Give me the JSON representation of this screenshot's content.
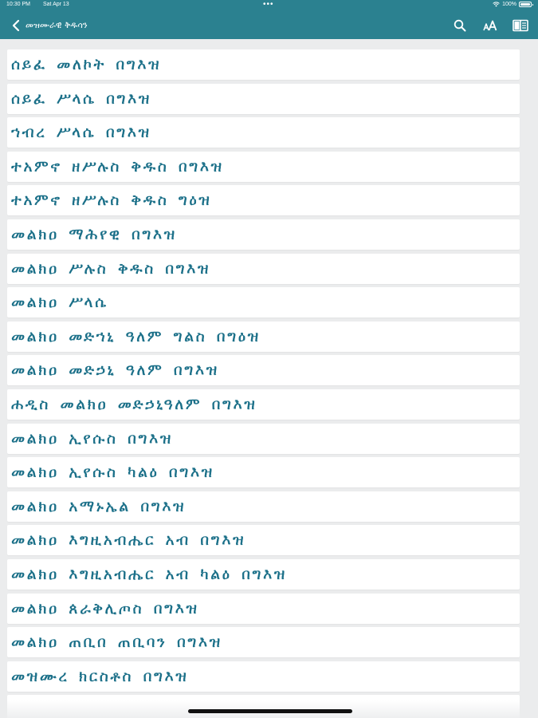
{
  "status_bar": {
    "time": "10:30 PM",
    "date": "Sat Apr 13",
    "dots": "•••",
    "battery": "100%"
  },
  "nav": {
    "title": "መዝሙራዊ ቅዱሳን",
    "back_icon": "chevron-left-icon",
    "actions": [
      "search-icon",
      "text-size-icon",
      "book-icon"
    ]
  },
  "colors": {
    "header": "#2b8190",
    "item_text": "#1a6f88",
    "background": "#ebeced",
    "item_background": "#ffffff"
  },
  "list": {
    "items": [
      {
        "label": "ሰይፈ መለኮት በግእዝ"
      },
      {
        "label": "ሰይፈ ሥላሴ በግእዝ"
      },
      {
        "label": "ኀብረ ሥላሴ በግእዝ"
      },
      {
        "label": "ተአምኖ ዘሥሉስ ቅዱስ በግእዝ"
      },
      {
        "label": "ተአምኖ ዘሥሉስ ቅዱስ ግዕዝ"
      },
      {
        "label": "መልክዐ ማሕየዊ በግእዝ"
      },
      {
        "label": "መልክዐ ሥሉስ ቅዱስ በግእዝ"
      },
      {
        "label": "መልክዐ ሥላሴ"
      },
      {
        "label": "መልክዐ መድኀኒ ዓለም ግልስ በግዕዝ"
      },
      {
        "label": "መልክዐ መድኃኒ ዓለም በግእዝ"
      },
      {
        "label": "ሐዲስ መልክዐ መድኃኒዓለም በግእዝ"
      },
      {
        "label": "መልክዐ ኢየሱስ በግእዝ"
      },
      {
        "label": "መልክዐ ኢየሱስ ካልዕ በግእዝ"
      },
      {
        "label": "መልክዐ አማኑኤል በግእዝ"
      },
      {
        "label": "መልክዐ እግዚአብሔር አብ በግእዝ"
      },
      {
        "label": "መልክዐ እግዚአብሔር አብ ካልዕ በግእዝ"
      },
      {
        "label": "መልክዐ ጰራቅሊጦስ በግእዝ"
      },
      {
        "label": "መልክዐ ጠቢበ ጠቢባን በግእዝ"
      },
      {
        "label": "መዝሙረ ክርስቶስ በግእዝ"
      }
    ]
  }
}
